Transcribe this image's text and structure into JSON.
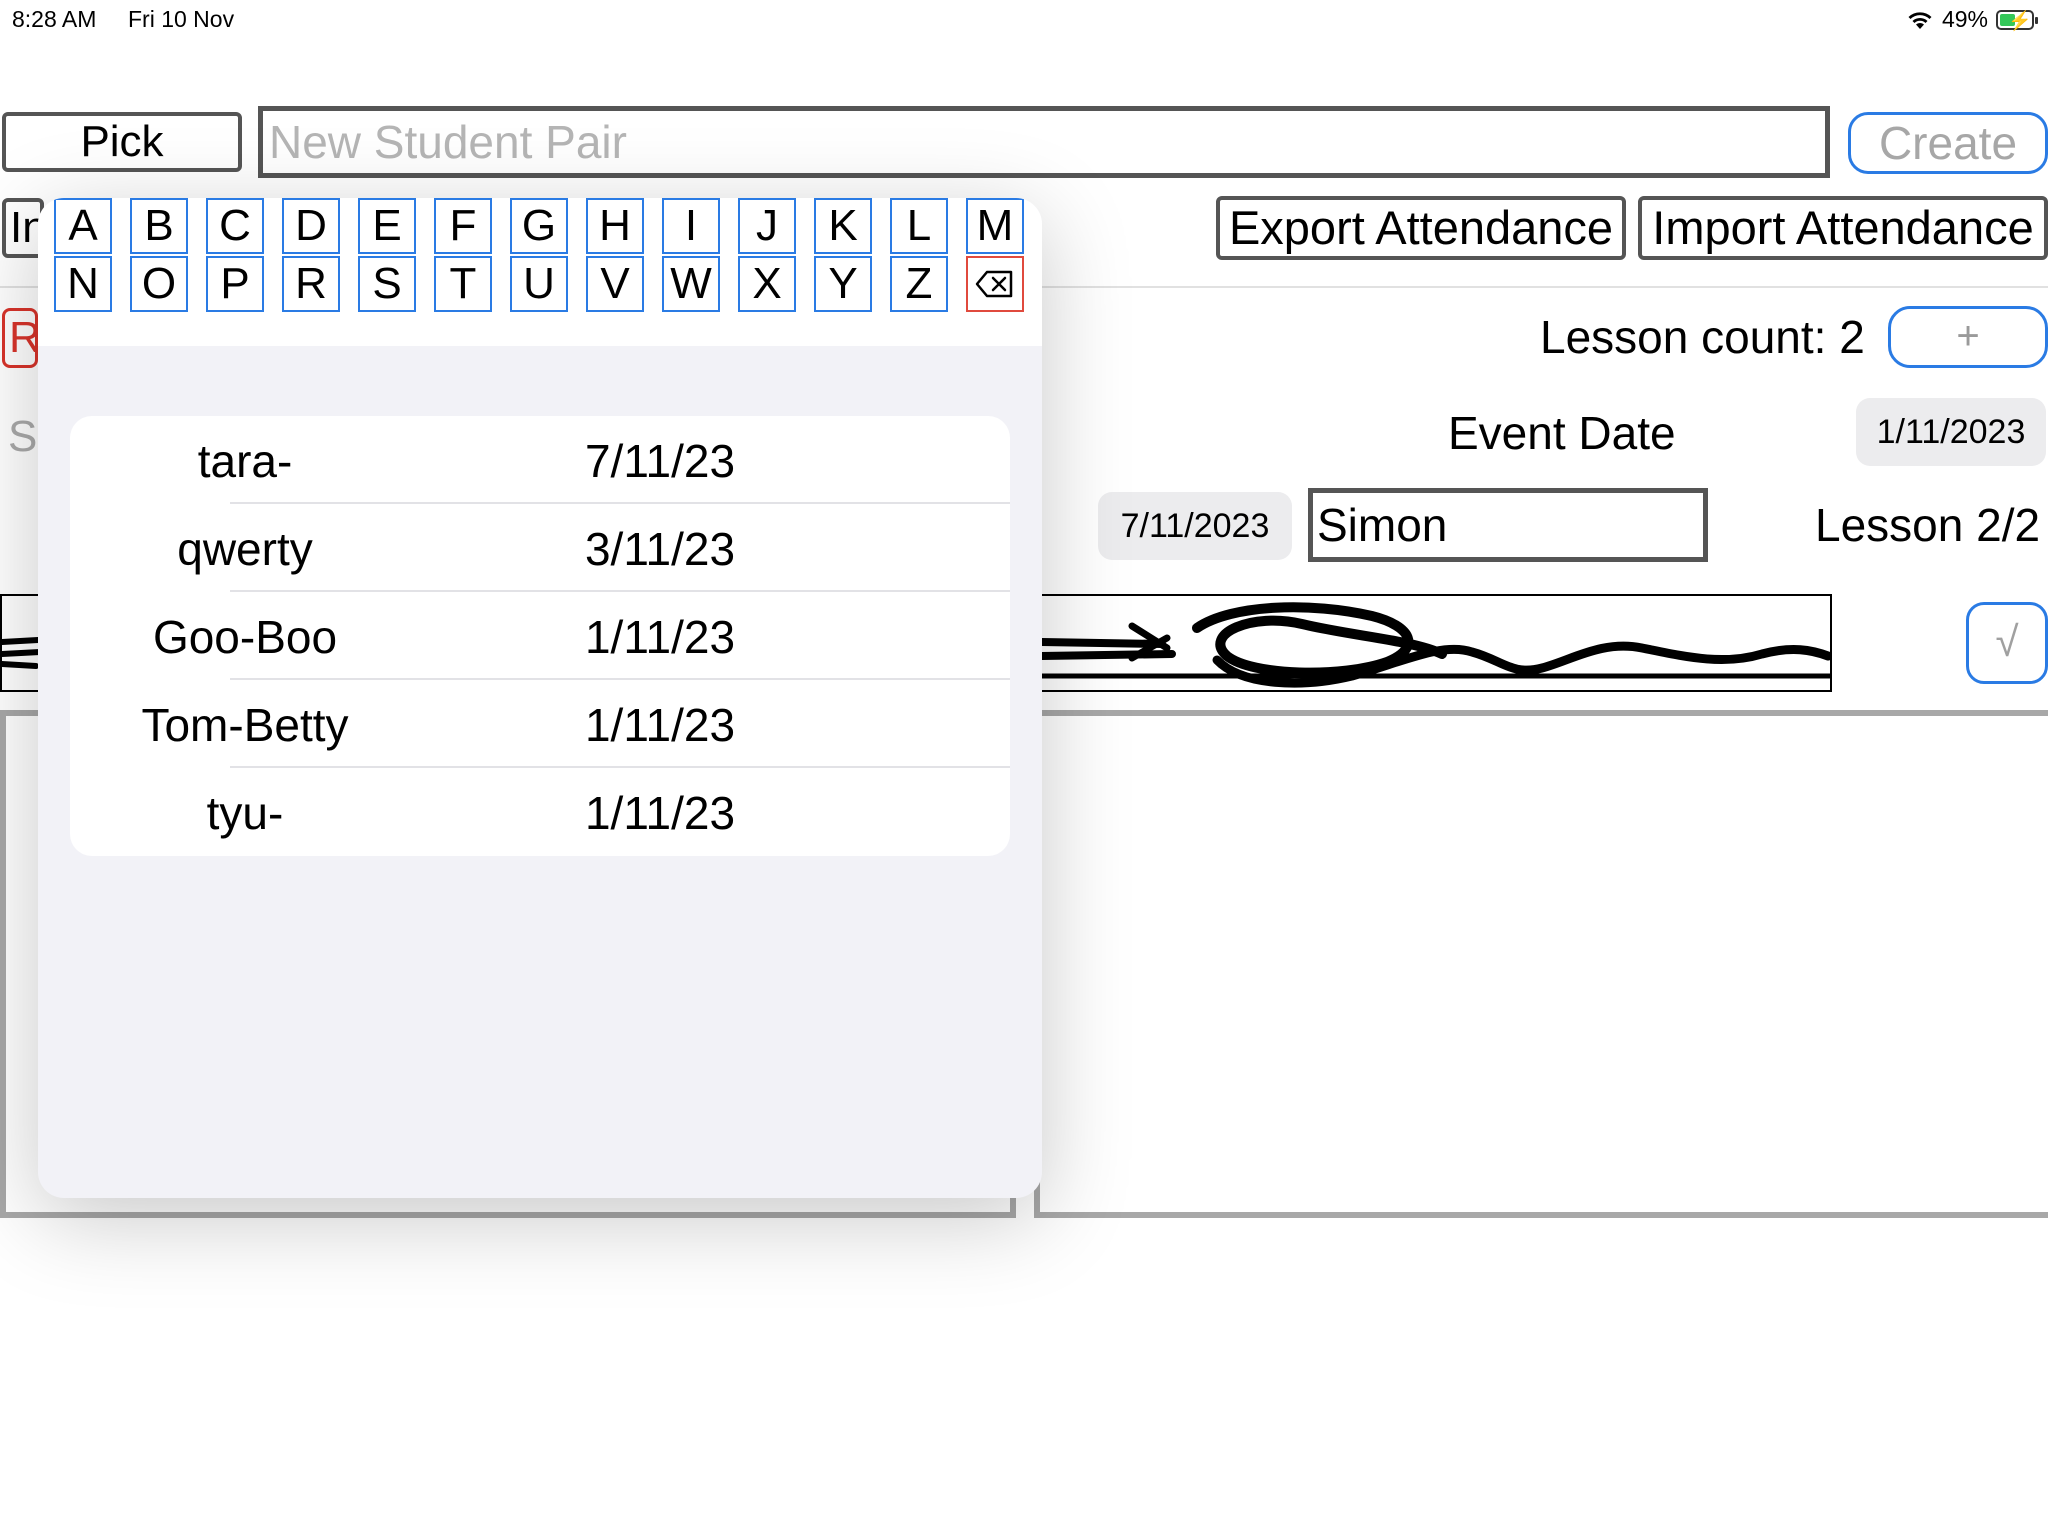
{
  "status_bar": {
    "time": "8:28 AM",
    "date": "Fri 10 Nov",
    "battery": "49%",
    "battery_level": 0.49,
    "wifi_icon": "wifi-icon",
    "battery_icon": "battery-charging-icon"
  },
  "top_bar": {
    "pick_label": "Pick",
    "new_pair_placeholder": "New Student Pair",
    "create_label": "Create"
  },
  "toolbar": {
    "import_left_label": "In",
    "export_label": "Export Attendance",
    "import_label": "Import Attendance"
  },
  "lesson": {
    "reset_label": "R",
    "count_text": "Lesson count: 2",
    "plus_label": "+",
    "s_label": "S",
    "event_date_label": "Event Date",
    "event_date_value": "1/11/2023",
    "session_date_value": "7/11/2023",
    "student_name": "Simon",
    "progress_text": "Lesson 2/2",
    "confirm_label": "√"
  },
  "picker": {
    "letters_row1": [
      "A",
      "B",
      "C",
      "D",
      "E",
      "F",
      "G",
      "H",
      "I",
      "J",
      "K",
      "L",
      "M"
    ],
    "letters_row2": [
      "N",
      "O",
      "P",
      "R",
      "S",
      "T",
      "U",
      "V",
      "W",
      "X",
      "Y",
      "Z"
    ],
    "delete_icon": "backspace-icon",
    "results": [
      {
        "name": "tara-",
        "date": "7/11/23"
      },
      {
        "name": "qwerty",
        "date": "3/11/23"
      },
      {
        "name": "Goo-Boo",
        "date": "1/11/23"
      },
      {
        "name": "Tom-Betty",
        "date": "1/11/23"
      },
      {
        "name": "tyu-",
        "date": "1/11/23"
      }
    ]
  },
  "colors": {
    "accent": "#2a7be4",
    "destructive": "#d9342b",
    "popover_bg": "#f2f2f7"
  }
}
